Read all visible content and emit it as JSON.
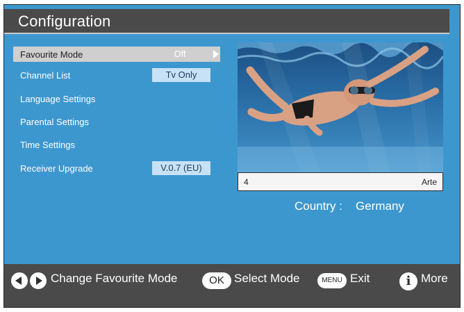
{
  "header": {
    "title": "Configuration"
  },
  "menu": {
    "items": [
      {
        "label": "Favourite Mode",
        "value": "Off",
        "selected": true
      },
      {
        "label": "Channel List",
        "value": "Tv Only"
      },
      {
        "label": "Language Settings"
      },
      {
        "label": "Parental Settings"
      },
      {
        "label": "Time Settings"
      },
      {
        "label": "Receiver Upgrade",
        "value": "V.0.7 (EU)"
      }
    ]
  },
  "preview": {
    "channel_number": "4",
    "channel_name": "Arte",
    "country_label": "Country :",
    "country_value": "Germany"
  },
  "footer": {
    "left_right_icon": "left-right-arrows-icon",
    "change_label": "Change Favourite Mode",
    "ok_key": "OK",
    "select_label": "Select Mode",
    "menu_key": "MENU",
    "exit_label": "Exit",
    "info_key": "i",
    "more_label": "More"
  },
  "colors": {
    "background_blue": "#3d97cf",
    "bar_grey": "#4a4a4a",
    "selection_grey": "#cfcfcf",
    "value_box": "#c7e2f6"
  }
}
